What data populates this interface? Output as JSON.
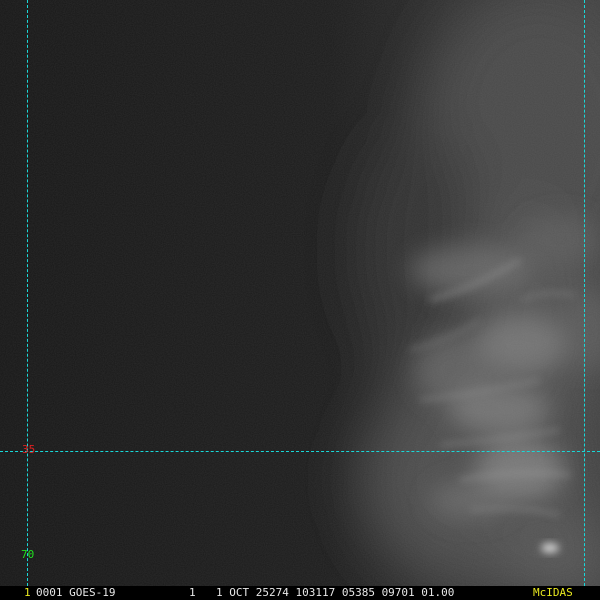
{
  "overlay": {
    "grid_color": "#18d8d8",
    "labels": {
      "lat_35": {
        "text": "35",
        "color": "#e02020"
      },
      "lat_70": {
        "text": "70",
        "color": "#20e020"
      },
      "corner": {
        "text": "1",
        "color": "#e8e820"
      }
    }
  },
  "status_bar": {
    "frame_info": "0001 GOES-19",
    "band": "1",
    "info": "1 OCT 25274 103117 05385 09701 01.00",
    "brand": "McIDAS",
    "text_color": "#e8e8e8",
    "brand_color": "#e8e820"
  }
}
